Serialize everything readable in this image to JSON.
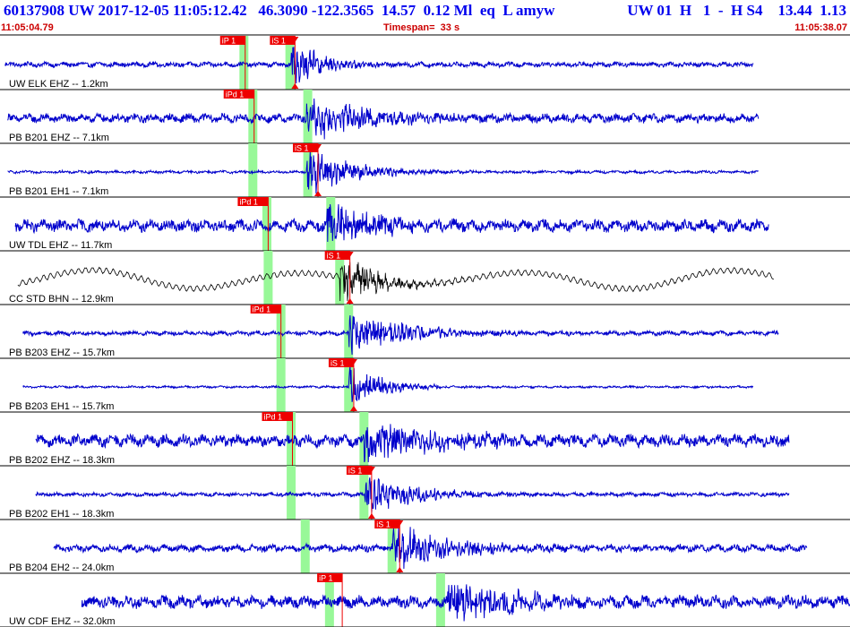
{
  "header": {
    "event_line": "60137908 UW 2017-12-05 11:05:12.42   46.3090 -122.3565  14.57  0.12 Ml  eq  L amyw",
    "right_line": "UW 01  H   1  -  H S4    13.44  1.13",
    "start_time": "11:05:04.79",
    "timespan": "Timespan=  33 s",
    "end_time": "11:05:38.07"
  },
  "colors": {
    "trace": "#0000cc",
    "trace_broadband": "#000000",
    "pick_box": "#ee0000",
    "pick_text": "#ffffff",
    "theoretical_window": "#98f898",
    "separator": "#000000"
  },
  "chart_data": {
    "type": "line",
    "title": "",
    "xlabel": "",
    "ylabel": "",
    "x_unit": "s",
    "xlim": [
      0,
      33.28
    ],
    "traces": [
      {
        "name": "UW ELK EHZ -- 1.2km",
        "trace_start": 0.2,
        "trace_end": 29.5,
        "noise": 0.09,
        "windows": [
          9.55,
          11.35
        ],
        "picks": [
          {
            "label": "iP 1",
            "t": 9.6
          },
          {
            "label": "iS 1",
            "t": 11.55
          }
        ],
        "burst": {
          "t": 11.4,
          "amp": 0.9,
          "decay": 1.2
        }
      },
      {
        "name": "PB B201 EHZ -- 7.1km",
        "trace_start": 0.3,
        "trace_end": 29.7,
        "noise": 0.16,
        "windows": [
          9.9,
          12.05
        ],
        "picks": [
          {
            "label": "iPd 1",
            "t": 9.95
          }
        ],
        "burst": {
          "t": 12.0,
          "amp": 0.8,
          "decay": 2.6
        }
      },
      {
        "name": "PB B201 EH1 -- 7.1km",
        "trace_start": 0.3,
        "trace_end": 29.7,
        "noise": 0.05,
        "windows": [
          9.9,
          12.05
        ],
        "picks": [
          {
            "label": "iS 1",
            "t": 12.45
          }
        ],
        "burst": {
          "t": 12.0,
          "amp": 0.9,
          "decay": 1.8
        }
      },
      {
        "name": "UW TDL EHZ -- 11.7km",
        "trace_start": 0.6,
        "trace_end": 30.1,
        "noise": 0.22,
        "windows": [
          10.45,
          12.95
        ],
        "picks": [
          {
            "label": "iPd 1",
            "t": 10.5
          }
        ],
        "burst": {
          "t": 12.8,
          "amp": 1.0,
          "decay": 1.8
        }
      },
      {
        "name": "CC STD BHN -- 12.9km",
        "trace_start": 0.7,
        "trace_end": 30.3,
        "noise": 0.05,
        "windows": [
          10.5,
          13.3
        ],
        "picks": [
          {
            "label": "iS 1",
            "t": 13.7
          }
        ],
        "burst": {
          "t": 13.3,
          "amp": 1.0,
          "decay": 1.5
        }
      },
      {
        "name": "PB B203 EHZ -- 15.7km",
        "trace_start": 0.9,
        "trace_end": 30.5,
        "noise": 0.08,
        "windows": [
          11.0,
          13.65
        ],
        "picks": [
          {
            "label": "iPd 1",
            "t": 11.0
          }
        ],
        "burst": {
          "t": 13.65,
          "amp": 0.95,
          "decay": 2.2
        }
      },
      {
        "name": "PB B203 EH1 -- 15.7km",
        "trace_start": 0.9,
        "trace_end": 29.5,
        "noise": 0.04,
        "windows": [
          11.0,
          13.65
        ],
        "picks": [
          {
            "label": "iS 1",
            "t": 13.85
          }
        ],
        "burst": {
          "t": 13.65,
          "amp": 0.9,
          "decay": 1.2
        }
      },
      {
        "name": "PB B202 EHZ -- 18.3km",
        "trace_start": 1.4,
        "trace_end": 30.9,
        "noise": 0.22,
        "windows": [
          11.4,
          14.25
        ],
        "picks": [
          {
            "label": "iPd 1",
            "t": 11.45
          }
        ],
        "burst": {
          "t": 14.25,
          "amp": 0.95,
          "decay": 2.4
        }
      },
      {
        "name": "PB B202 EH1 -- 18.3km",
        "trace_start": 1.4,
        "trace_end": 30.9,
        "noise": 0.07,
        "windows": [
          11.4,
          14.25
        ],
        "picks": [
          {
            "label": "iS 1",
            "t": 14.55
          }
        ],
        "burst": {
          "t": 14.25,
          "amp": 0.9,
          "decay": 1.8
        }
      },
      {
        "name": "PB B204 EH2 -- 24.0km",
        "trace_start": 2.1,
        "trace_end": 31.6,
        "noise": 0.13,
        "windows": [
          11.95,
          15.35
        ],
        "picks": [
          {
            "label": "iS 1",
            "t": 15.65
          }
        ],
        "burst": {
          "t": 15.35,
          "amp": 0.85,
          "decay": 2.4
        }
      },
      {
        "name": "UW CDF EHZ -- 32.0km",
        "trace_start": 3.2,
        "trace_end": 33.28,
        "noise": 0.22,
        "windows": [
          12.9,
          17.25
        ],
        "picks": [
          {
            "label": "iP 1",
            "t": 13.4
          }
        ],
        "burst": {
          "t": 17.5,
          "amp": 0.9,
          "decay": 2.4
        }
      }
    ]
  }
}
